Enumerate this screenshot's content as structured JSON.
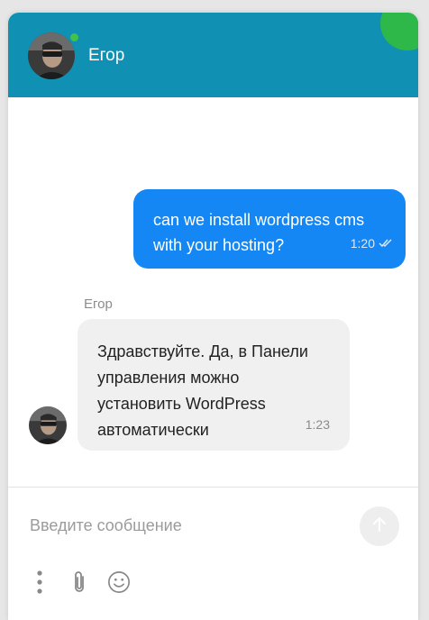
{
  "header": {
    "agent_name": "Егор",
    "status": "online",
    "colors": {
      "background": "#1091b4",
      "status_dot": "#43c24b",
      "corner_accent": "#2eb84a"
    }
  },
  "messages": [
    {
      "direction": "outgoing",
      "lines": [
        "can we install wordpress cms",
        "with your hosting?"
      ],
      "time": "1:20",
      "status_icon": "double-check-icon",
      "color": "#1487f5"
    },
    {
      "direction": "incoming",
      "sender": "Егор",
      "lines": [
        "Здравствуйте. Да, в Панели",
        "управления можно",
        "установить WordPress",
        "автоматически"
      ],
      "time": "1:23",
      "color": "#f0f0f0"
    }
  ],
  "composer": {
    "placeholder": "Введите сообщение",
    "value": "",
    "send_icon": "arrow-up-icon",
    "tools": [
      "more-vertical-icon",
      "paperclip-icon",
      "smiley-icon"
    ]
  }
}
